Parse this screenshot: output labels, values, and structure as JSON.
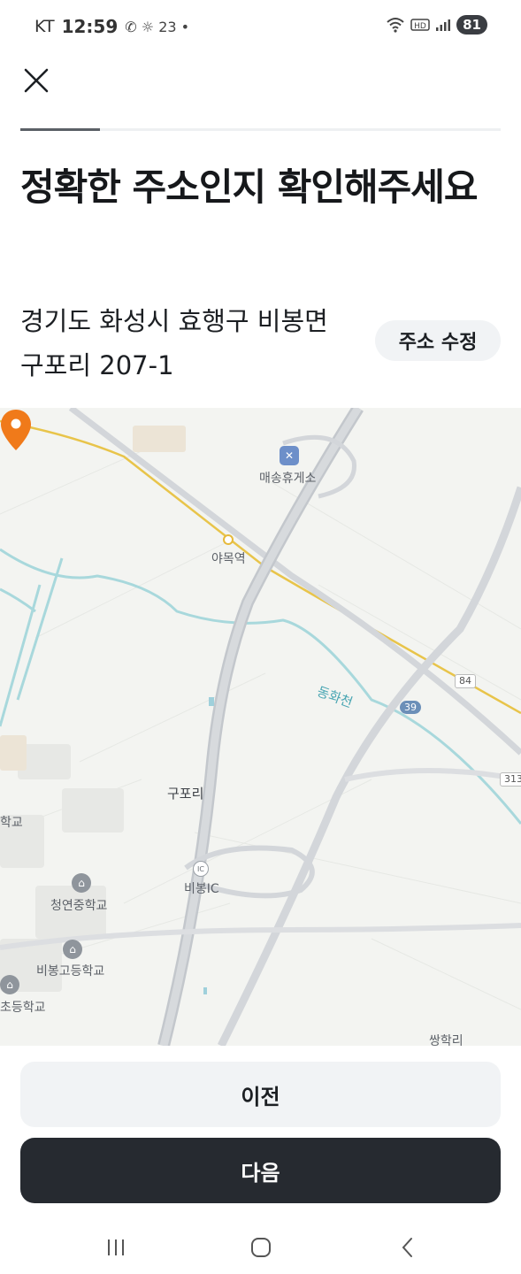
{
  "status_bar": {
    "carrier": "KT",
    "time": "12:59",
    "notification_number": "23",
    "battery": "81"
  },
  "progress": {
    "fraction": 0.165
  },
  "title": "정확한 주소인지 확인해주세요",
  "address": {
    "text": "경기도 화성시 효행구 비봉면 구포리 207-1",
    "edit_label": "주소 수정"
  },
  "map": {
    "labels": {
      "rest_area": "매송휴게소",
      "station": "야목역",
      "river": "동화천",
      "village": "구포리",
      "ic": "비봉IC",
      "ic_badge": "IC",
      "school1": "청연중학교",
      "school2": "비봉고등학교",
      "school3": "초등학교",
      "school_left": "학교",
      "ssanghak": "쌍학리"
    },
    "road_numbers": {
      "r84": "84",
      "r39": "39",
      "r313": "313"
    },
    "colors": {
      "background": "#f3f4f1",
      "expressway": "#c9cdd2",
      "railway": "#e8c44a",
      "river": "#a8d8dc",
      "pin": "#f07a1a"
    }
  },
  "buttons": {
    "prev": "이전",
    "next": "다음"
  },
  "icons": {
    "close": "close-icon",
    "nav_recent": "recent-apps-icon",
    "nav_home": "home-icon",
    "nav_back": "back-icon"
  }
}
